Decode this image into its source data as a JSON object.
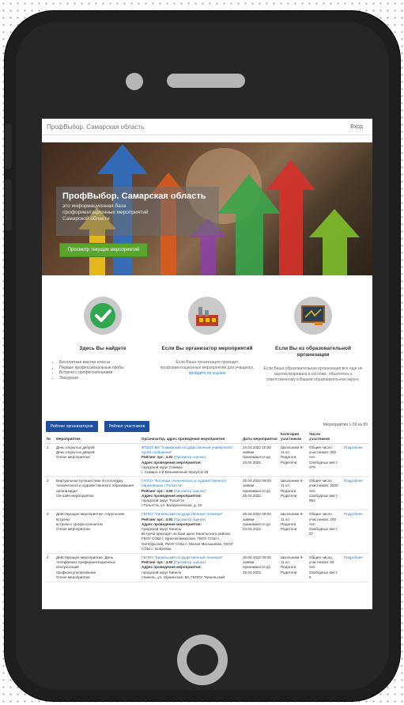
{
  "site": {
    "brand": "ПрофВыбор. Самарская область",
    "login": "Вход"
  },
  "hero": {
    "title": "ПрофВыбор. Самарская область",
    "sub1": "это информационная база",
    "sub2": "профориентационных мероприятий",
    "sub3": "Самарской области",
    "button": "Просмотр текущих мероприятий"
  },
  "features": [
    {
      "title": "Здесь Вы найдете",
      "items": [
        "Бесплатные мастер-классы",
        "Первые профессиональные пробы",
        "Встречи с профессионалами",
        "Экскурсии"
      ]
    },
    {
      "title": "Если Вы организатор мероприятий",
      "text": "Если Ваша организация проводит профориентационные мероприятия для учащихся,",
      "link": "пройдите по ссылке"
    },
    {
      "title": "Если Вы из образовательной организации",
      "text": "Если Ваша образовательная организация все еще не зарегистрирована в системе, обратитесь к ответственному в Вашем образовательном округе."
    }
  ],
  "buttons": {
    "organizers": "Рейтинг организаторов",
    "participants": "Рейтинг участников"
  },
  "pagination": "Мероприятия 1-50 из 89",
  "table": {
    "headers": [
      "№",
      "Мероприятие",
      "Организатор, адрес проведения мероприятия",
      "Даты мероприятия",
      "Категория участников",
      "Число участников",
      ""
    ],
    "rows": [
      {
        "n": "1",
        "event": [
          "День открытых дверей",
          "День открытых дверей",
          "Очное мероприятие"
        ],
        "org": "ФГБОУ ВО \"Самарский государственный университет путей сообщения\"",
        "rating": "4.92",
        "rating_link": "(Просмотр оценок)",
        "addr_label": "Адрес проведения мероприятия:",
        "addr": "городской округ Самара",
        "addr2": "г. Самара 1-й Безымянный переулок 18.",
        "dates": [
          "24.04.2022 10:00",
          "заявки",
          "принимаются до",
          "23.04.2022"
        ],
        "cat": [
          "Школьники 9-",
          "11 кл.",
          "Педагоги",
          "Родители"
        ],
        "num": [
          "Общее число",
          "участников: 300",
          "чел.",
          "Свободных мест:",
          "279"
        ],
        "more": "Подробнее"
      },
      {
        "n": "2",
        "event": [
          "Виртуальное путешествие по колледжу",
          "технического и художественного образования",
          "организация",
          "Он-лайн мероприятие"
        ],
        "org": "ГАПОУ \"Колледж технического и художественного образования г.Тольятти\"",
        "rating": "4.95",
        "rating_link": "(Просмотр оценок)",
        "addr_label": "Адрес проведения мероприятия:",
        "addr": "городской округ Тольятти",
        "addr2": "г.Тольятти, ул. Воскресенская, д. 10",
        "dates": [
          "25.04.2022 09:00",
          "заявки",
          "принимаются до",
          "25.04.2022"
        ],
        "cat": [
          "Школьники 9-",
          "11 кл.",
          "Педагоги",
          "Родители"
        ],
        "num": [
          "Общее число",
          "участников: 2000",
          "чел.",
          "Свободных мест:",
          "983"
        ],
        "more": "Подробнее"
      },
      {
        "n": "3",
        "event": [
          "Действующее мероприятие. Апрельские",
          "встречи:",
          "встречи с профессионалом",
          "Очное мероприятие"
        ],
        "org": "ГБПОУ \"Кинельский государственный техникум\"",
        "rating": "4.92",
        "rating_link": "(Просмотр оценок)",
        "addr_label": "Адрес проведения мероприятия:",
        "addr": "городской округ Кинель",
        "addr2": "Встречи проходят на базе школ Кинельского района: ГБОУ СОШ с. Красносамарское, ГБОУ СОШ с. Октябрьский, ГБОУ СОШ с. Малая Малышевка, ГБОУ СОШ с. Бобровка",
        "dates": [
          "25.04.2022 09:00",
          "заявки",
          "принимаются до",
          "24.04.2022"
        ],
        "cat": [
          "Школьники 9-",
          "11 кл.",
          "Педагоги",
          "Родители"
        ],
        "num": [
          "Общее число",
          "участников: 200",
          "чел.",
          "Свободных мест:",
          "27"
        ],
        "more": "Подробнее"
      },
      {
        "n": "4",
        "event": [
          "Действующее мероприятие. День",
          "телефонных профориентационных",
          "консультаций",
          "профконсультирование",
          "Очное мероприятие"
        ],
        "org": "ГБПОУ \"Кинельский государственный техникум\"",
        "rating": "4.92",
        "rating_link": "(Просмотр оценок)",
        "addr_label": "Адрес проведения мероприятия:",
        "addr": "городской округ Кинель",
        "addr2": "г.Кинель, ул. Украинская, 58, ГБПОУ \"Кинельский",
        "dates": [
          "25.04.2022 09:00",
          "заявки",
          "принимаются до",
          "25.04.2022"
        ],
        "cat": [
          "Школьники 9-",
          "11 кл.",
          "Педагоги",
          "Родители"
        ],
        "num": [
          "Общее число",
          "участников: 50",
          "чел.",
          "Свободных мест:",
          "5"
        ],
        "more": "Подробнее"
      }
    ]
  },
  "rating_label": "Рейтинг орг.:"
}
